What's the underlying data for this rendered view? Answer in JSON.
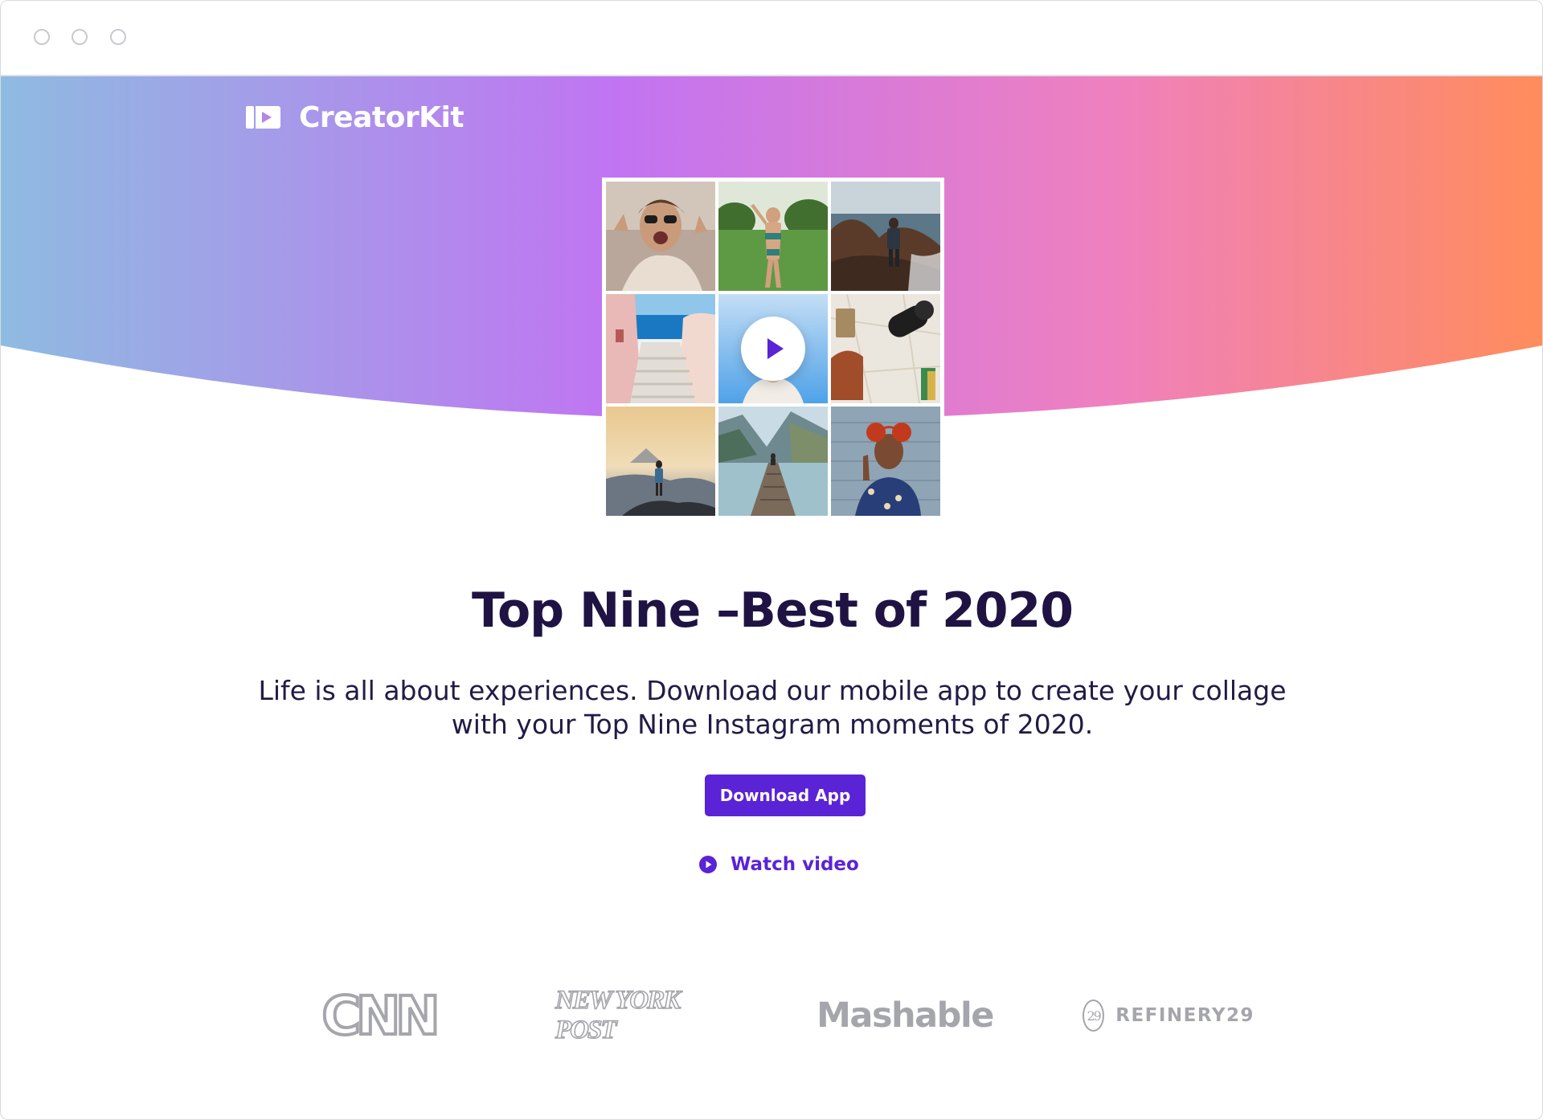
{
  "brand": {
    "name": "CreatorKit",
    "icon": "creatorkit-logo-icon"
  },
  "hero": {
    "headline": "Top Nine –Best of 2020",
    "subtitle": "Life is all about experiences. Download our mobile app to create your collage with your Top Nine Instagram moments of 2020.",
    "gradient": [
      "#8ebbe1",
      "#c174f2",
      "#ea7fc7",
      "#ff8c5b"
    ]
  },
  "collage": {
    "tiles": [
      {
        "icon": "photo-woman-sunglasses"
      },
      {
        "icon": "photo-woman-garden"
      },
      {
        "icon": "photo-hiker-cliffs"
      },
      {
        "icon": "photo-santorini-stairs"
      },
      {
        "icon": "photo-video-woman",
        "has_play": true
      },
      {
        "icon": "photo-travel-flatlay"
      },
      {
        "icon": "photo-sunrise-mountain"
      },
      {
        "icon": "photo-lake-pier"
      },
      {
        "icon": "photo-woman-red-hair"
      }
    ],
    "play_icon": "play-icon"
  },
  "actions": {
    "download_label": "Download App",
    "watch_label": "Watch video",
    "accent": "#5a23d6"
  },
  "press": {
    "cnn": "CNN",
    "nypost": "NEW YORK POST",
    "mashable": "Mashable",
    "refinery_mark": "29",
    "refinery": "REFINERY29"
  }
}
